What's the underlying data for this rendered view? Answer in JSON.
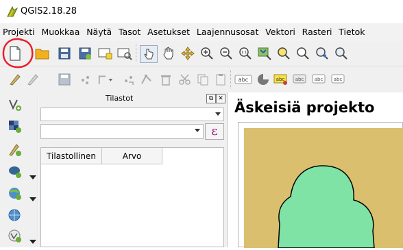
{
  "window": {
    "title": "QGIS2.18.28"
  },
  "menubar": {
    "items": [
      "Projekti",
      "Muokkaa",
      "Näytä",
      "Tasot",
      "Asetukset",
      "Laajennusosat",
      "Vektori",
      "Rasteri",
      "Tietok"
    ]
  },
  "toolbar1": {
    "icons": [
      "new-project-icon",
      "open-project-icon",
      "save-project-icon",
      "save-as-icon",
      "print-composer-icon",
      "composer-manager-icon",
      "touch-zoom-icon",
      "pan-icon",
      "pan-to-selection-icon",
      "zoom-in-icon",
      "zoom-out-icon",
      "zoom-native-icon",
      "zoom-full-icon",
      "zoom-to-selection-icon",
      "zoom-to-layer-icon",
      "zoom-last-icon",
      "zoom-next-icon"
    ]
  },
  "toolbar2": {
    "icons": [
      "current-edits-icon",
      "toggle-editing-icon",
      "save-layer-edits-icon",
      "add-feature-icon",
      "digitize-dropdown-icon",
      "move-feature-icon",
      "node-tool-icon",
      "delete-selected-icon",
      "cut-features-icon",
      "copy-features-icon",
      "paste-features-icon",
      "label-toolbar-icon",
      "layer-labeling-icon",
      "pin-labels-icon",
      "show-hide-labels-icon",
      "move-label-icon",
      "rotate-label-icon"
    ],
    "label_icon_text": "abc"
  },
  "left_toolbar": {
    "icons": [
      "add-vector-layer-icon",
      "add-raster-layer-icon",
      "add-delimited-text-icon",
      "add-postgis-layer-icon",
      "add-spatialite-layer-icon",
      "add-wms-layer-icon",
      "add-wfs-layer-icon"
    ]
  },
  "stats_panel": {
    "title": "Tilastot",
    "layer_combo_value": "",
    "field_combo_value": "",
    "expression_button_glyph": "ε",
    "columns": [
      "Tilastollinen",
      "Arvo"
    ]
  },
  "recent_projects": {
    "heading": "Äskeisiä projekto"
  },
  "colors": {
    "annotation_red": "#e8202a",
    "map_background": "#d9bf6e",
    "map_polygon": "#7fe3a6",
    "expression_accent": "#a0187a"
  }
}
